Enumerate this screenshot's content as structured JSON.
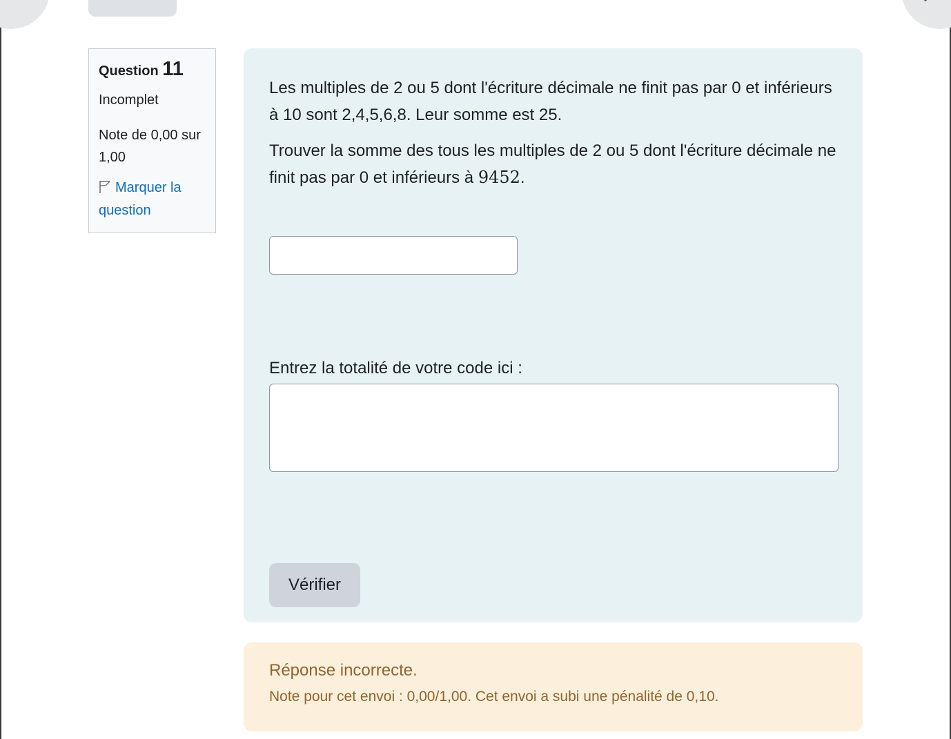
{
  "question": {
    "label": "Question",
    "number": "11",
    "state": "Incomplet",
    "grade": "Note de 0,00 sur 1,00",
    "flag_label": "Marquer la question"
  },
  "question_text": {
    "paragraph1": "Les multiples de 2 ou 5 dont l'écriture décimale ne finit pas par 0 et inférieurs à 10 sont 2,4,5,6,8. Leur somme est 25.",
    "paragraph2_before": "Trouver la somme des tous les multiples de 2 ou 5 dont l'écriture décimale ne finit pas par 0 et inférieurs à ",
    "paragraph2_math": "9452",
    "paragraph2_after": "."
  },
  "answer": {
    "value": ""
  },
  "code": {
    "label": "Entrez la totalité de votre code ici :",
    "value": ""
  },
  "check_button": "Vérifier",
  "feedback": {
    "title": "Réponse incorrecte.",
    "grade_text": "Note pour cet envoi : 0,00/1,00. Cet envoi a subi une pénalité de 0,10."
  },
  "colors": {
    "content_bg": "#e7f2f5",
    "feedback_bg": "#fcefdc",
    "feedback_text": "#8e662e",
    "link": "#0f6cbf"
  },
  "icons": {
    "flag": "flag-icon"
  }
}
